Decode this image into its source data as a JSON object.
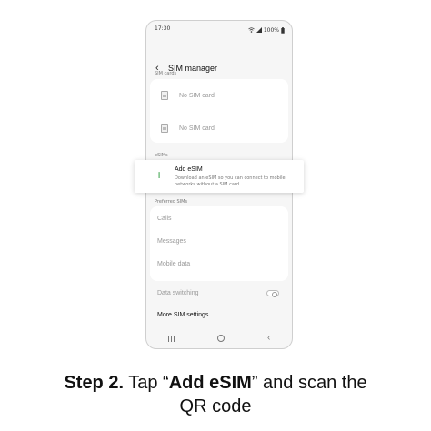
{
  "status_bar": {
    "time": "17:30",
    "battery": "100%",
    "icons": [
      "wifi-icon",
      "signal-icon",
      "battery-icon"
    ]
  },
  "header": {
    "back_icon": "back-arrow-icon",
    "title": "SIM manager"
  },
  "sim_cards": {
    "label": "SIM cards",
    "items": [
      {
        "label": "No SIM card",
        "icon": "sim-card-icon"
      },
      {
        "label": "No SIM card",
        "icon": "sim-card-icon"
      }
    ]
  },
  "esims": {
    "label": "eSIMs",
    "add": {
      "icon": "plus-icon",
      "title": "Add eSIM",
      "description": "Download an eSIM so you can connect to mobile networks without a SIM card."
    }
  },
  "preferred_sims": {
    "label": "Preferred SIMs",
    "items": [
      "Calls",
      "Messages",
      "Mobile data"
    ]
  },
  "data_switching": {
    "label": "Data switching",
    "enabled": false
  },
  "more_settings": "More SIM settings",
  "nav_bar": {
    "icons": [
      "recents-icon",
      "home-icon",
      "back-icon"
    ]
  },
  "caption": {
    "step": "Step 2.",
    "prefix": "Tap “",
    "highlight": "Add eSIM",
    "suffix": "” and scan the",
    "line2": "QR code"
  },
  "colors": {
    "accent_green": "#3ba34a",
    "background": "#f6f6f6"
  }
}
